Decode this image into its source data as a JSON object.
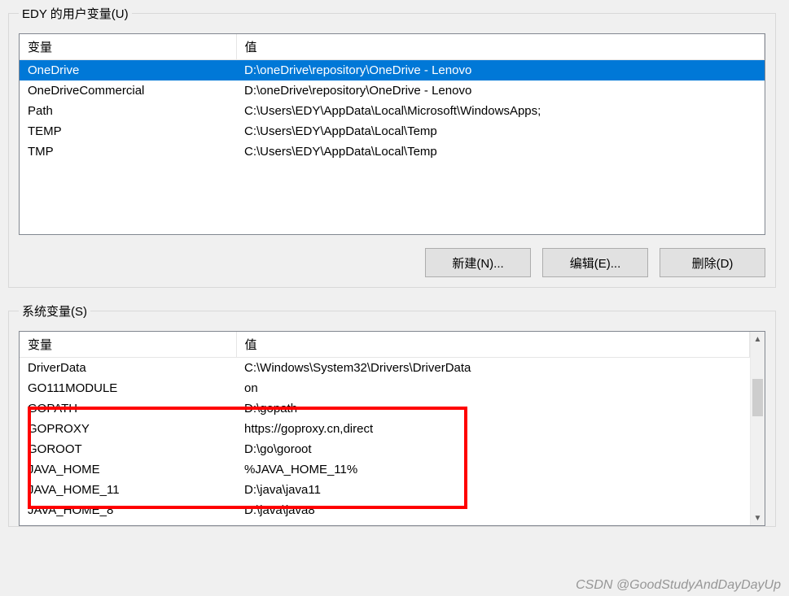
{
  "user_section": {
    "legend": "EDY 的用户变量(U)",
    "headers": {
      "var": "变量",
      "val": "值"
    },
    "rows": [
      {
        "var": "OneDrive",
        "val": "D:\\oneDrive\\repository\\OneDrive - Lenovo",
        "selected": true
      },
      {
        "var": "OneDriveCommercial",
        "val": "D:\\oneDrive\\repository\\OneDrive - Lenovo",
        "selected": false
      },
      {
        "var": "Path",
        "val": "C:\\Users\\EDY\\AppData\\Local\\Microsoft\\WindowsApps;",
        "selected": false
      },
      {
        "var": "TEMP",
        "val": "C:\\Users\\EDY\\AppData\\Local\\Temp",
        "selected": false
      },
      {
        "var": "TMP",
        "val": "C:\\Users\\EDY\\AppData\\Local\\Temp",
        "selected": false
      }
    ],
    "buttons": {
      "new": "新建(N)...",
      "edit": "编辑(E)...",
      "delete": "删除(D)"
    }
  },
  "system_section": {
    "legend": "系统变量(S)",
    "headers": {
      "var": "变量",
      "val": "值"
    },
    "rows": [
      {
        "var": "DriverData",
        "val": "C:\\Windows\\System32\\Drivers\\DriverData"
      },
      {
        "var": "GO111MODULE",
        "val": "on"
      },
      {
        "var": "GOPATH",
        "val": "D:\\gopath"
      },
      {
        "var": "GOPROXY",
        "val": "https://goproxy.cn,direct"
      },
      {
        "var": "GOROOT",
        "val": "D:\\go\\goroot"
      },
      {
        "var": "JAVA_HOME",
        "val": "%JAVA_HOME_11%"
      },
      {
        "var": "JAVA_HOME_11",
        "val": "D:\\java\\java11"
      },
      {
        "var": "JAVA_HOME_8",
        "val": "D:\\java\\java8"
      }
    ]
  },
  "watermark": "CSDN @GoodStudyAndDayDayUp"
}
